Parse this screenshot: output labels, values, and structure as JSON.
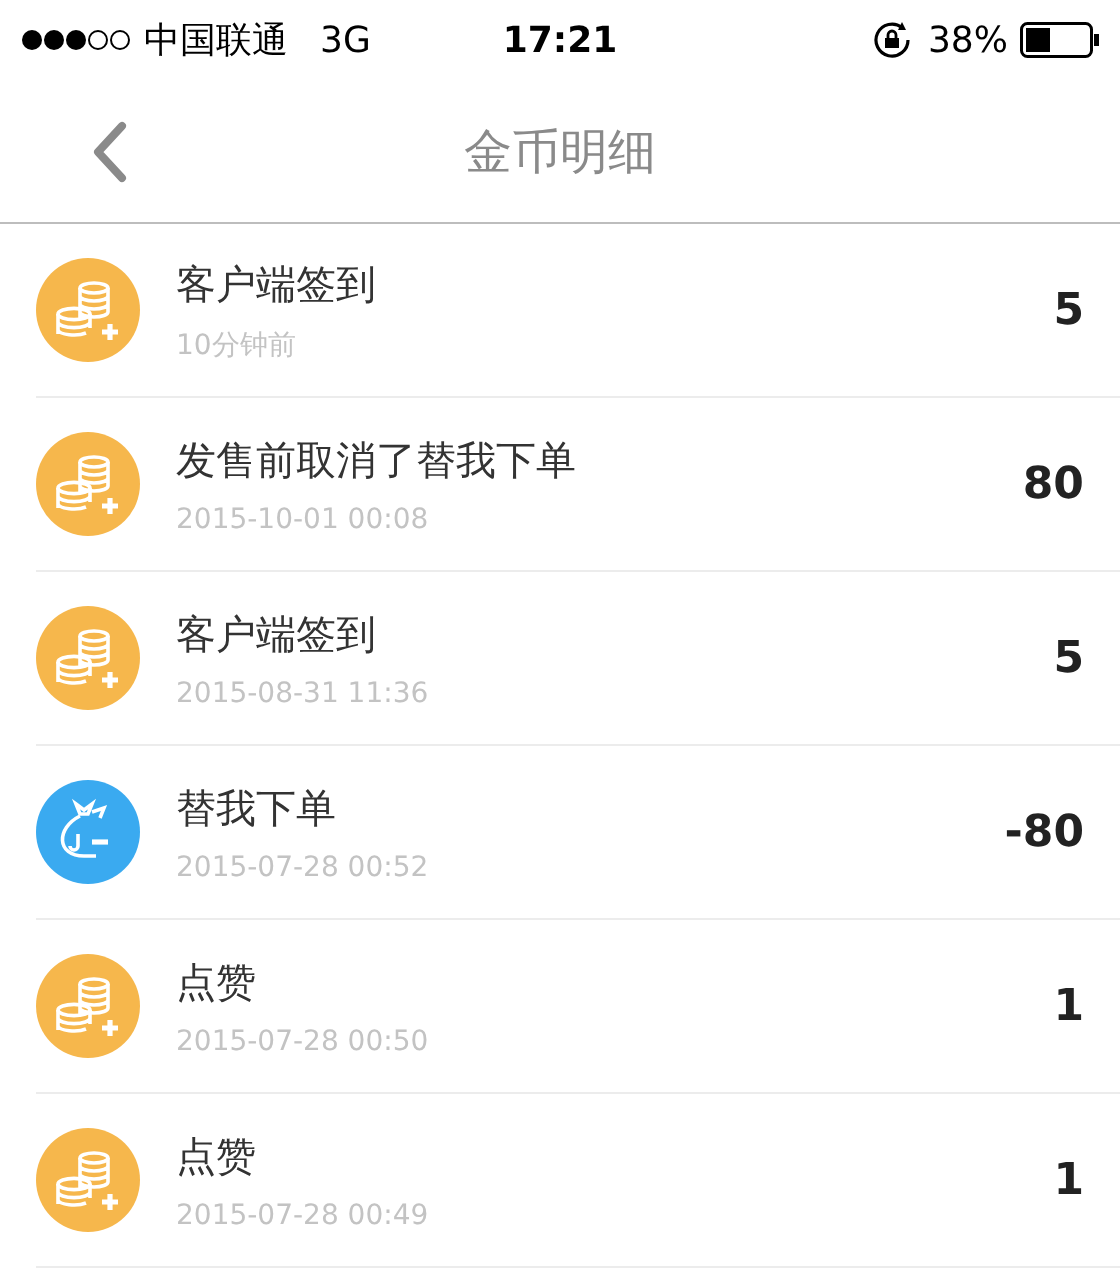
{
  "status_bar": {
    "carrier": "中国联通",
    "network": "3G",
    "time": "17:21",
    "battery": "38%"
  },
  "nav": {
    "title": "金币明细"
  },
  "records": [
    {
      "kind": "earn",
      "title": "客户端签到",
      "time": "10分钟前",
      "amount": "5"
    },
    {
      "kind": "earn",
      "title": "发售前取消了替我下单",
      "time": "2015-10-01 00:08",
      "amount": "80"
    },
    {
      "kind": "earn",
      "title": "客户端签到",
      "time": "2015-08-31 11:36",
      "amount": "5"
    },
    {
      "kind": "spend",
      "title": "替我下单",
      "time": "2015-07-28 00:52",
      "amount": "-80"
    },
    {
      "kind": "earn",
      "title": "点赞",
      "time": "2015-07-28 00:50",
      "amount": "1"
    },
    {
      "kind": "earn",
      "title": "点赞",
      "time": "2015-07-28 00:49",
      "amount": "1"
    }
  ]
}
